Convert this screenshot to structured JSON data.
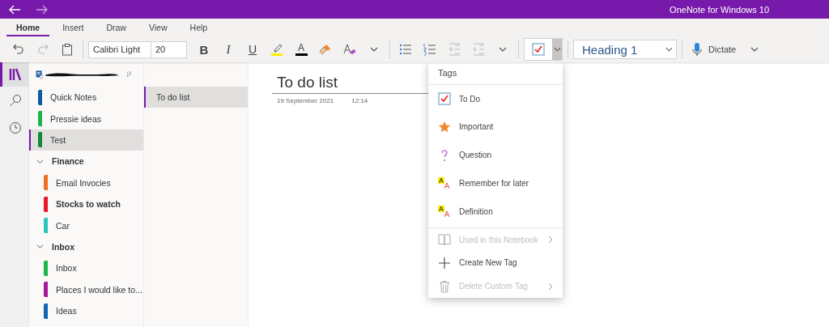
{
  "window": {
    "title": "OneNote for Windows 10"
  },
  "ribbon_tabs": [
    {
      "label": "Home",
      "selected": true
    },
    {
      "label": "Insert",
      "selected": false
    },
    {
      "label": "Draw",
      "selected": false
    },
    {
      "label": "View",
      "selected": false
    },
    {
      "label": "Help",
      "selected": false
    }
  ],
  "toolbar": {
    "font": "Calibri Light",
    "size": "20",
    "bold": "B",
    "italic": "I",
    "underline": "U",
    "font_color": "A",
    "style": "Heading 1",
    "dictate": "Dictate",
    "tag_menu_open": true
  },
  "rail": [
    {
      "kind": "notebooks",
      "selected": true
    },
    {
      "kind": "search",
      "selected": false
    },
    {
      "kind": "recent",
      "selected": false
    }
  ],
  "sections": [
    {
      "kind": "section",
      "name": "Quick Notes",
      "color": "#0f5aa0",
      "selected": false,
      "bold": false
    },
    {
      "kind": "section",
      "name": "Pressie ideas",
      "color": "#1ab64c",
      "selected": false,
      "bold": false
    },
    {
      "kind": "section",
      "name": "Test",
      "color": "#118a3c",
      "selected": true,
      "bold": false
    },
    {
      "kind": "group",
      "name": "Finance",
      "expanded": true,
      "children": [
        {
          "kind": "section",
          "name": "Email Invocies",
          "color": "#f07020",
          "selected": false,
          "bold": false
        },
        {
          "kind": "section",
          "name": "Stocks to watch",
          "color": "#e8192c",
          "selected": false,
          "bold": true
        },
        {
          "kind": "section",
          "name": "Car",
          "color": "#2cc4bc",
          "selected": false,
          "bold": false
        }
      ]
    },
    {
      "kind": "group",
      "name": "Inbox",
      "expanded": true,
      "children": [
        {
          "kind": "section",
          "name": "Inbox",
          "color": "#1ab64c",
          "selected": false,
          "bold": false
        },
        {
          "kind": "section",
          "name": "Places I would like to...",
          "color": "#a8179a",
          "selected": false,
          "bold": false
        },
        {
          "kind": "section",
          "name": "Ideas",
          "color": "#1066b4",
          "selected": false,
          "bold": false
        }
      ]
    }
  ],
  "pages": [
    {
      "title": "To do list",
      "selected": true
    }
  ],
  "page": {
    "title": "To do list",
    "date": "19 September 2021",
    "time": "12:14"
  },
  "tags_menu": {
    "title": "Tags",
    "items": [
      {
        "kind": "todo",
        "label": "To Do",
        "disabled": false,
        "submenu": false
      },
      {
        "kind": "star",
        "label": "Important",
        "disabled": false,
        "submenu": false
      },
      {
        "kind": "question",
        "label": "Question",
        "disabled": false,
        "submenu": false
      },
      {
        "kind": "remember",
        "label": "Remember for later",
        "disabled": false,
        "submenu": false
      },
      {
        "kind": "remember",
        "label": "Definition",
        "disabled": false,
        "submenu": false
      },
      {
        "kind": "book",
        "label": "Used in this Notebook",
        "disabled": true,
        "submenu": true
      },
      {
        "kind": "plus",
        "label": "Create New Tag",
        "disabled": false,
        "submenu": false
      },
      {
        "kind": "trash",
        "label": "Delete Custom Tag",
        "disabled": true,
        "submenu": true
      }
    ]
  }
}
